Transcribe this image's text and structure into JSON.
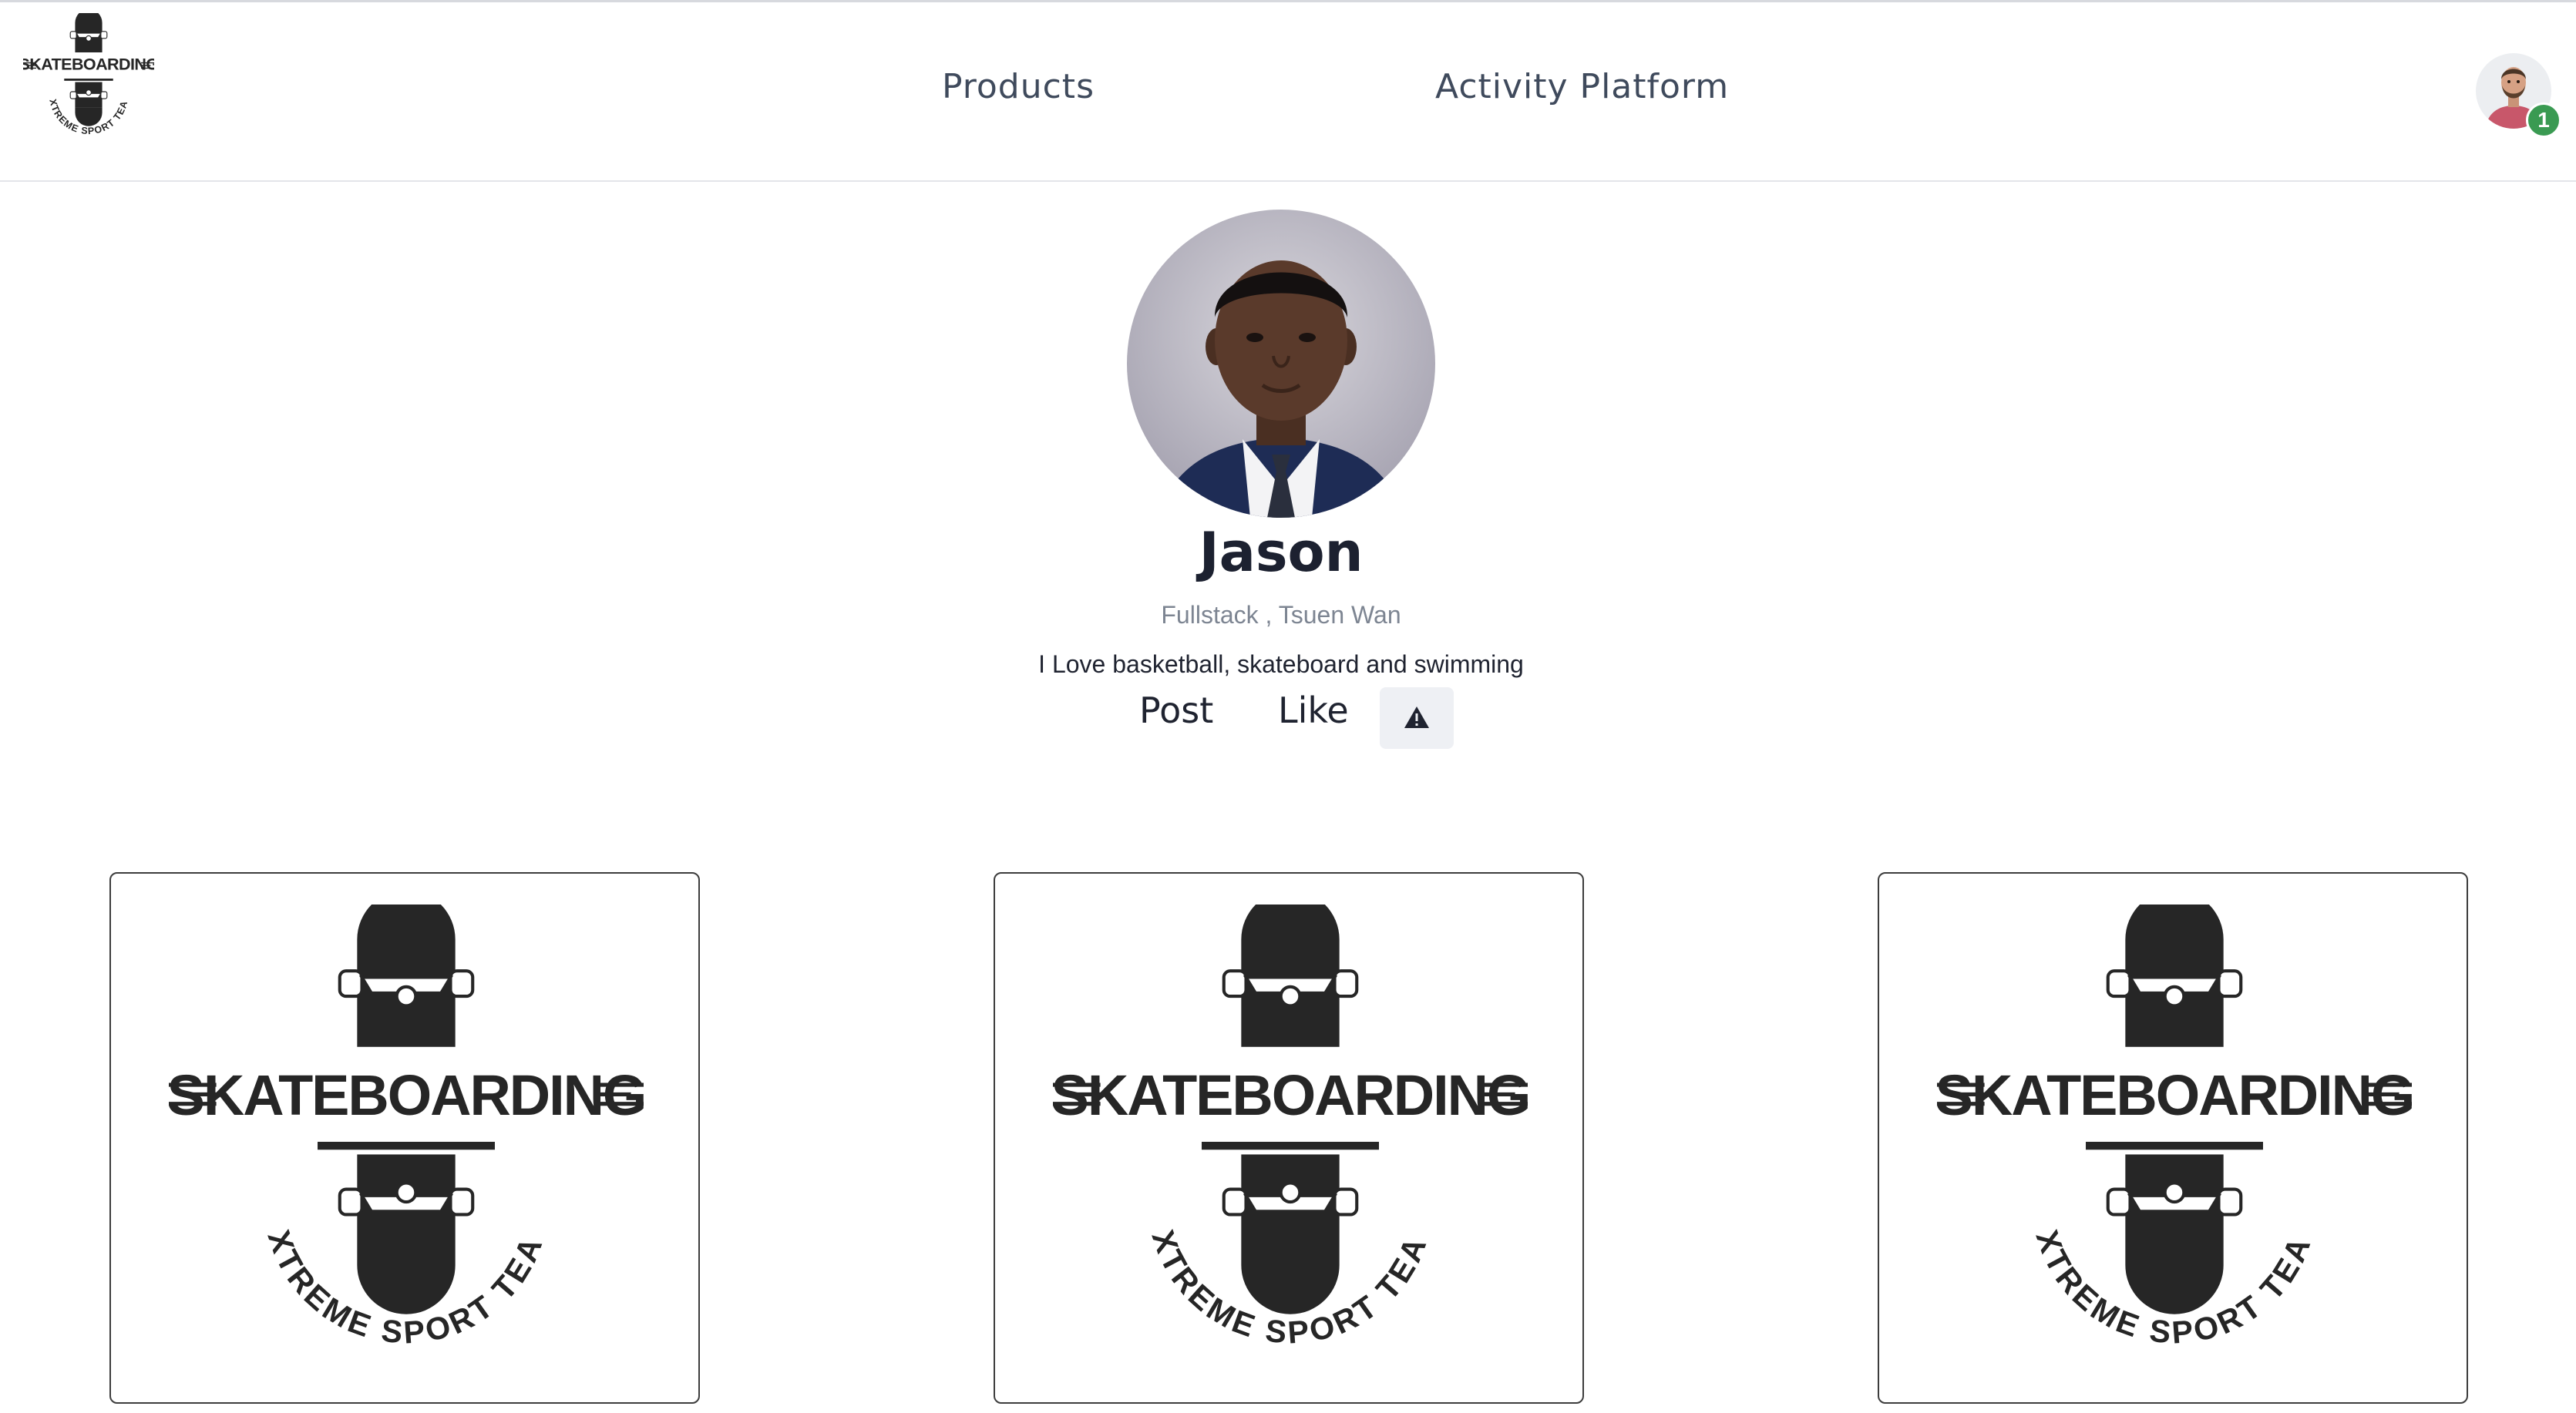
{
  "header": {
    "logo": {
      "icon": "skateboarding-logo-icon",
      "title": "SKATEBOARDING",
      "subtitle": "EXTREME SPORT TEAM"
    },
    "nav": [
      {
        "label": "Products"
      },
      {
        "label": "Activity Platform"
      }
    ],
    "user": {
      "avatar_icon": "user-avatar-icon",
      "notification_count": "1"
    }
  },
  "profile": {
    "photo_icon": "profile-photo-icon",
    "name": "Jason",
    "meta": "Fullstack , Tsuen Wan",
    "bio": "I Love basketball, skateboard and swimming",
    "actions": {
      "post_label": "Post",
      "like_label": "Like",
      "report_icon": "warning-triangle-icon"
    }
  },
  "posts": [
    {
      "image_icon": "skateboarding-logo-icon",
      "title": "SKATEBOARDING",
      "subtitle": "EXTREME SPORT TEAM"
    },
    {
      "image_icon": "skateboarding-logo-icon",
      "title": "SKATEBOARDING",
      "subtitle": "EXTREME SPORT TEAM"
    },
    {
      "image_icon": "skateboarding-logo-icon",
      "title": "SKATEBOARDING",
      "subtitle": "EXTREME SPORT TEAM"
    }
  ],
  "colors": {
    "nav_text": "#3f4a5c",
    "badge": "#3a9a52",
    "logo_dark": "#262626",
    "report_bg": "#eef0f4"
  }
}
